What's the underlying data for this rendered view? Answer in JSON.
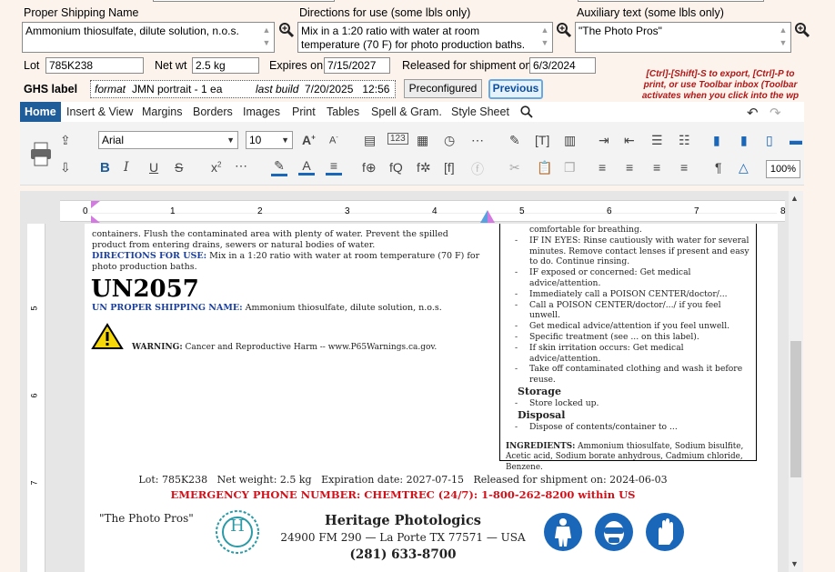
{
  "form": {
    "proper_shipping_label": "Proper Shipping Name",
    "proper_shipping_value": "Ammonium thiosulfate, dilute solution, n.o.s.",
    "directions_label": "Directions for use (some lbls only)",
    "directions_value": "Mix in a 1:20 ratio with water at room temperature (70 F) for photo production baths.",
    "auxiliary_label": "Auxiliary text (some lbls only)",
    "auxiliary_value": "\"The Photo Pros\"",
    "lot_label": "Lot",
    "lot_value": "785K238",
    "netwt_label": "Net wt",
    "netwt_value": "2.5 kg",
    "expires_label": "Expires on",
    "expires_value": "7/15/2027",
    "released_label": "Released for shipment on",
    "released_value": "6/3/2024",
    "ghs_label": "GHS label",
    "format_label": "format",
    "format_value": "JMN portrait - 1 ea",
    "lastbuild_label": "last build",
    "lastbuild_value": "7/20/2025   12:56",
    "preconfigured_btn": "Preconfigured",
    "previous_btn": "Previous",
    "hint_text": "[Ctrl]-[Shift]-S to export, [Ctrl]-P to print, or use Toolbar inbox (Toolbar activates when you click into the wp"
  },
  "ribbon": {
    "tabs": [
      "Home",
      "Insert & View",
      "Margins",
      "Borders",
      "Images",
      "Print",
      "Tables",
      "Spell & Gram.",
      "Style Sheet"
    ],
    "font_name": "Arial",
    "font_size": "10",
    "zoom": "100%"
  },
  "ruler": {
    "numbers": [
      "0",
      "1",
      "2",
      "3",
      "4",
      "5",
      "6",
      "7",
      "8"
    ],
    "vnumbers": [
      "5",
      "6",
      "7"
    ]
  },
  "doc": {
    "left_top_text": "containers. Flush the contaminated area with plenty of water. Prevent the spilled product from entering drains, sewers or natural bodies of water.",
    "directions_heading": "DIRECTIONS FOR USE:",
    "directions_text": "Mix in a 1:20 ratio with water at room temperature (70 F) for photo production baths.",
    "un_number": "UN2057",
    "psn_heading": "UN PROPER SHIPPING NAME:",
    "psn_text": "Ammonium thiosulfate, dilute solution, n.o.s.",
    "warning_heading": "WARNING:",
    "warning_text": "Cancer and Reproductive Harm -- www.P65Warnings.ca.gov.",
    "right_first_line": "comfortable for breathing.",
    "right_items": [
      "IF IN EYES: Rinse cautiously with water for several minutes. Remove contact lenses if present and easy to do. Continue rinsing.",
      "IF exposed or concerned: Get medical advice/attention.",
      "Immediately call a POISON CENTER/doctor/...",
      "Call a POISON CENTER/doctor/.../ if you feel unwell.",
      "Get medical advice/attention if you feel unwell.",
      "Specific treatment (see ... on this label).",
      "If skin irritation occurs: Get medical advice/attention.",
      "Take off contaminated clothing and wash it before reuse."
    ],
    "storage_heading": "Storage",
    "storage_item": "Store locked up.",
    "disposal_heading": "Disposal",
    "disposal_item": "Dispose of contents/container to ...",
    "ingredients_heading": "INGREDIENTS:",
    "ingredients_text": "Ammonium thiosulfate, Sodium bisulfite, Acetic acid, Sodium borate anhydrous, Cadmium chloride, Benzene.",
    "lot_line": "Lot: 785K238   Net weight: 2.5 kg   Expiration date: 2027-07-15   Released for shipment on: 2024-06-03",
    "emergency_line": "EMERGENCY PHONE NUMBER: CHEMTREC (24/7): 1-800-262-8200 within US",
    "aux_text": "\"The Photo Pros\"",
    "logo_letter": "H",
    "company_name": "Heritage Photologics",
    "company_address": "24900 FM 290 — La Porte TX 77571 — USA",
    "company_phone": "(281) 633-8700"
  },
  "colors": {
    "ribbon_active_tab": "#1f5d9a",
    "heading_blue": "#1a3f9e",
    "emergency_red": "#d0131b",
    "ppe_blue": "#1a66b8",
    "logo_teal": "#2a9aa6"
  }
}
